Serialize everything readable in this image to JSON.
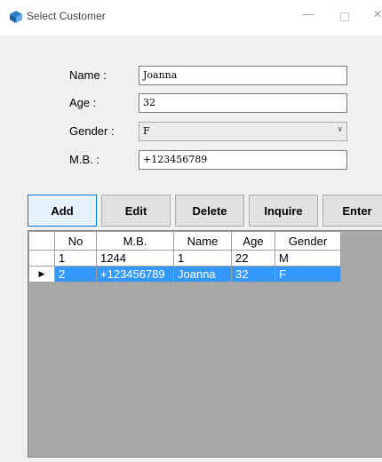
{
  "window": {
    "title": "Select Customer",
    "minimize_glyph": "—",
    "close_glyph": "✕"
  },
  "form": {
    "name_label": "Name :",
    "name_value": "Joanna",
    "age_label": "Age :",
    "age_value": "32",
    "gender_label": "Gender :",
    "gender_value": "F",
    "mb_label": "M.B. :",
    "mb_value": "+123456789"
  },
  "buttons": {
    "add": "Add",
    "edit": "Edit",
    "delete": "Delete",
    "inquire": "Inquire",
    "enter": "Enter"
  },
  "grid": {
    "columns": [
      "No",
      "M.B.",
      "Name",
      "Age",
      "Gender"
    ],
    "rows": [
      {
        "no": "1",
        "mb": "1244",
        "name": "1",
        "age": "22",
        "gender": "M"
      },
      {
        "no": "2",
        "mb": "+123456789",
        "name": "Joanna",
        "age": "32",
        "gender": "F"
      }
    ],
    "current_row_glyph": "▶"
  },
  "colors": {
    "selection": "#3399ff",
    "grid_background": "#a9a9a9",
    "active_button_border": "#0078d7"
  }
}
